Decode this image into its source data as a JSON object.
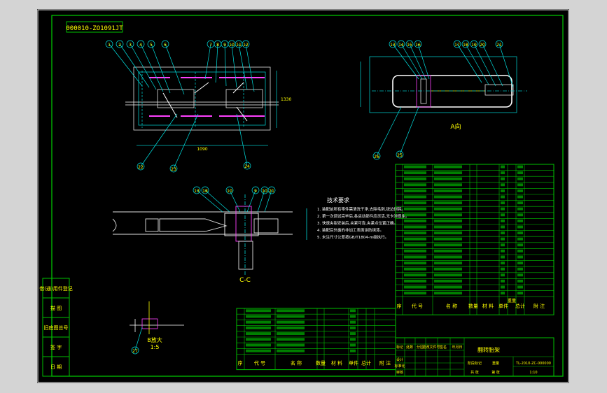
{
  "drawing": {
    "stamp_top": "000010-ZO1091JT",
    "colors": {
      "background": "#000000",
      "frame": "#00c000",
      "part_outline": "#e0e0e0",
      "dimension": "#00c0c0",
      "highlight": "#ff40ff",
      "frame_outer": "#ffffff",
      "balloon": "#00e0e0",
      "text": "#ffff00"
    },
    "left_side_panel": [
      "借(通)用件登记",
      "描  图",
      "旧底图总号",
      "签  字",
      "日  期"
    ],
    "front_view_balloons": [
      "1",
      "2",
      "3",
      "4",
      "5",
      "6",
      "7",
      "8",
      "9",
      "10",
      "11",
      "12"
    ],
    "front_view_bottom_balloons": [
      "22",
      "23",
      "24"
    ],
    "front_view_dims": [
      "1090",
      "1330"
    ],
    "right_view_balloons": [
      "13",
      "14",
      "15",
      "16",
      "17",
      "18",
      "19",
      "20",
      "21"
    ],
    "right_view_bottom_balloons": [
      "26",
      "25"
    ],
    "right_view_label": "A向",
    "section_balloons": [
      "13",
      "18",
      "10",
      "9",
      "10",
      "21"
    ],
    "section_label": "C-C",
    "detail_label": "B放大",
    "detail_scale": "1:5",
    "detail_balloon": "27",
    "tech_requirements": {
      "title": "技术要求",
      "items": [
        "1. 装配前所有零件需清洗干净,去除毛刺,锐边倒钝。",
        "2. 第一次调试完毕后,各运动部件应灵活,无卡滞现象。",
        "3. 快速夹钳安装后,夹紧可靠,夹紧点位置正确。",
        "4. 装配后外露的非加工表面涂防锈漆。",
        "5. 未注尺寸公差按GB/T1804-m级执行。"
      ]
    },
    "parts_table_right_rows": 22,
    "parts_table_left_rows": 8,
    "parts_table_header": [
      "序",
      "代   号",
      "名   称",
      "数量",
      "材   料",
      "单件",
      "总计",
      "附   注"
    ],
    "parts_header_sub": "重量",
    "title_block": {
      "name": "翻转胎架",
      "code": "TL-2010-ZC-000000",
      "material": "",
      "scale": "1:10",
      "labels": [
        "标记",
        "处数",
        "分区",
        "更改文件号",
        "签名",
        "年月日",
        "设计",
        "标准化",
        "审核",
        "工艺",
        "批准",
        "阶段标记",
        "重量",
        "比例",
        "共 张",
        "第 张"
      ]
    }
  }
}
